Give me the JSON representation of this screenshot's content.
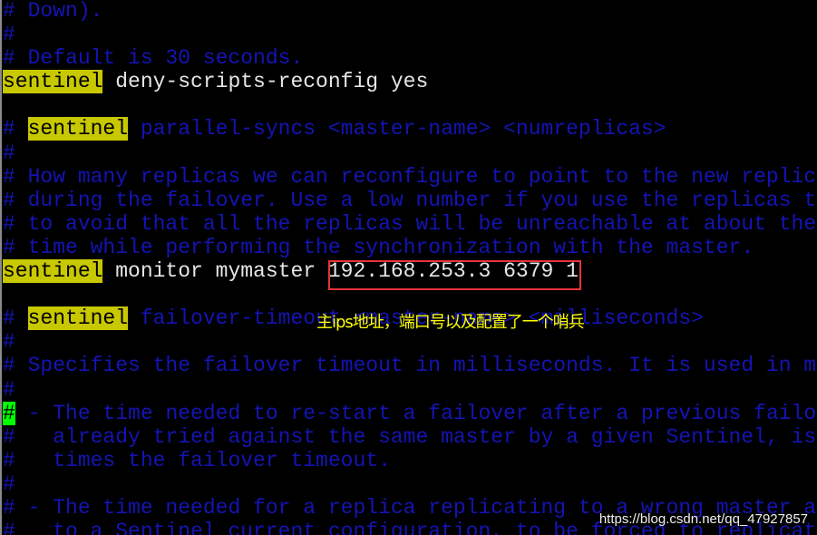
{
  "colors": {
    "comment": "#1414b4",
    "text": "#e6e6e6",
    "search_highlight": "#c8c800",
    "cursor": "#00ff00",
    "annotation_box": "#e8343a",
    "annotation_text": "#ffff00"
  },
  "editor": {
    "lines": [
      [
        {
          "s": "comment",
          "t": "# Down)."
        }
      ],
      [
        {
          "s": "comment",
          "t": "#"
        }
      ],
      [
        {
          "s": "comment",
          "t": "# Default is 30 seconds."
        }
      ],
      [
        {
          "s": "hl",
          "t": "sentinel"
        },
        {
          "s": "normal",
          "t": " deny-scripts-reconfig yes"
        }
      ],
      [],
      [
        {
          "s": "comment",
          "t": "# "
        },
        {
          "s": "hl",
          "t": "sentinel"
        },
        {
          "s": "comment",
          "t": " parallel-syncs <master-name> <numreplicas>"
        }
      ],
      [
        {
          "s": "comment",
          "t": "#"
        }
      ],
      [
        {
          "s": "comment",
          "t": "# How many replicas we can reconfigure to point to the new replica"
        }
      ],
      [
        {
          "s": "comment",
          "t": "# during the failover. Use a low number if you use the replicas to"
        }
      ],
      [
        {
          "s": "comment",
          "t": "# to avoid that all the replicas will be unreachable at about the"
        }
      ],
      [
        {
          "s": "comment",
          "t": "# time while performing the synchronization with the master."
        }
      ],
      [
        {
          "s": "hl",
          "t": "sentinel"
        },
        {
          "s": "normal",
          "t": " monitor mymaster 192.168.253.3 6379 1"
        }
      ],
      [],
      [
        {
          "s": "comment",
          "t": "# "
        },
        {
          "s": "hl",
          "t": "sentinel"
        },
        {
          "s": "comment",
          "t": " failover-timeout <master-name> <milliseconds>"
        }
      ],
      [
        {
          "s": "comment",
          "t": "#"
        }
      ],
      [
        {
          "s": "comment",
          "t": "# Specifies the failover timeout in milliseconds. It is used in ma"
        }
      ],
      [
        {
          "s": "comment",
          "t": "#"
        }
      ],
      [
        {
          "s": "cursor",
          "t": "#"
        },
        {
          "s": "comment",
          "t": " - The time needed to re-start a failover after a previous failo"
        }
      ],
      [
        {
          "s": "comment",
          "t": "#   already tried against the same master by a given Sentinel, is"
        }
      ],
      [
        {
          "s": "comment",
          "t": "#   times the failover timeout."
        }
      ],
      [
        {
          "s": "comment",
          "t": "#"
        }
      ],
      [
        {
          "s": "comment",
          "t": "# - The time needed for a replica replicating to a wrong master a"
        }
      ],
      [
        {
          "s": "comment",
          "t": "#   to a Sentinel current configuration, to be forced to replicat"
        }
      ]
    ]
  },
  "annotation": {
    "text": "主ips地址，端口号以及配置了一个哨兵"
  },
  "watermark": {
    "text": "https://blog.csdn.net/qq_47927857"
  }
}
